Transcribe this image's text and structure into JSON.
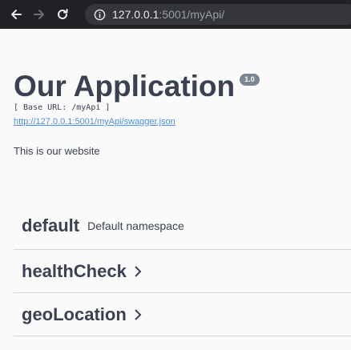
{
  "browser": {
    "url_host": "127.0.0.1",
    "url_rest": ":5001/myApi/",
    "back_icon": "arrow-left-icon",
    "forward_icon": "arrow-right-icon",
    "reload_icon": "reload-icon",
    "info_icon": "info-icon"
  },
  "header": {
    "title": "Our Application",
    "version": "1.0",
    "base_url": "[ Base URL: /myApi ]",
    "spec_link": "http://127.0.0.1:5001/myApi/swagger.json",
    "description": "This is our website"
  },
  "namespaces": [
    {
      "name": "default",
      "description": "Default namespace"
    },
    {
      "name": "healthCheck",
      "description": ""
    },
    {
      "name": "geoLocation",
      "description": ""
    }
  ],
  "colors": {
    "toolbar": "#202124",
    "text": "#3b4151",
    "link": "#4990e2",
    "badge": "#7d8492"
  }
}
